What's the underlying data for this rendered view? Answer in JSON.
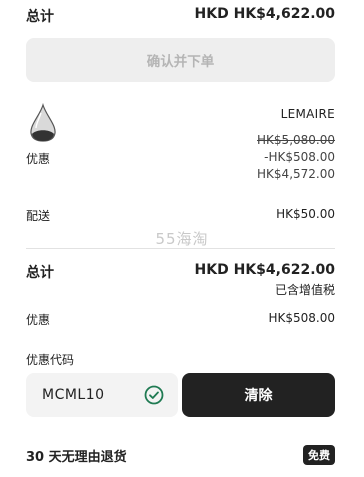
{
  "summary": {
    "total_label": "总计",
    "total_value": "HKD HK$4,622.00",
    "confirm_button": "确认并下单"
  },
  "item": {
    "brand": "LEMAIRE",
    "original_price": "HK$5,080.00",
    "discount_label": "优惠",
    "discount_value": "-HK$508.00",
    "final_price": "HK$4,572.00"
  },
  "shipping": {
    "label": "配送",
    "value": "HK$50.00"
  },
  "watermark": "55海淘",
  "totals": {
    "total_label": "总计",
    "total_value": "HKD HK$4,622.00",
    "tax_note": "已含增值税",
    "discount_label": "优惠",
    "discount_value": "HK$508.00"
  },
  "promo": {
    "label": "优惠代码",
    "code": "MCML10",
    "clear_button": "清除",
    "status_icon": "check-circle-icon",
    "accent_color": "#1f7a52"
  },
  "returns": {
    "label": "30 天无理由退货",
    "badge": "免费"
  }
}
